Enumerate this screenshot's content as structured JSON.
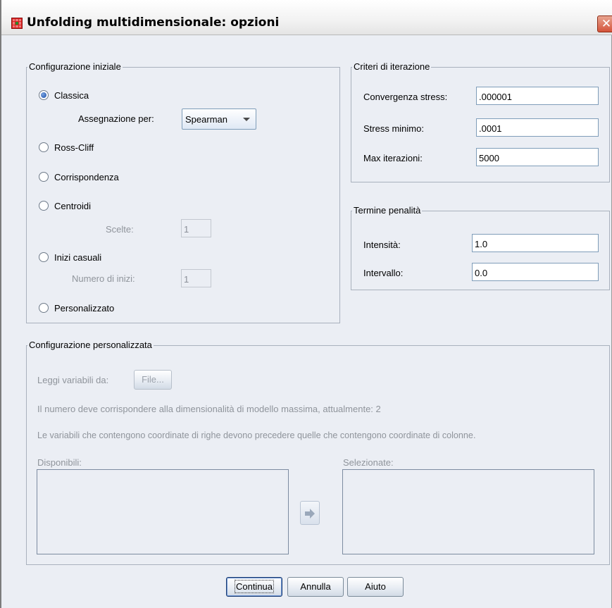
{
  "window": {
    "title": "Unfolding multidimensionale: opzioni",
    "close_glyph": "✕"
  },
  "initial_config": {
    "legend": "Configurazione iniziale",
    "classica": "Classica",
    "assegnazione_label": "Assegnazione per:",
    "assegnazione_value": "Spearman",
    "ross_cliff": "Ross-Cliff",
    "corrispondenza": "Corrispondenza",
    "centroidi": "Centroidi",
    "scelte_label": "Scelte:",
    "scelte_value": "1",
    "inizi_casuali": "Inizi casuali",
    "numero_inizi_label": "Numero di inizi:",
    "numero_inizi_value": "1",
    "personalizzato": "Personalizzato",
    "selected": "Classica"
  },
  "iteration": {
    "legend": "Criteri di iterazione",
    "convergenza_label": "Convergenza stress:",
    "convergenza_value": ".000001",
    "stress_min_label": "Stress minimo:",
    "stress_min_value": ".0001",
    "max_iter_label": "Max iterazioni:",
    "max_iter_value": "5000"
  },
  "penalty": {
    "legend": "Termine penalità",
    "intensita_label": "Intensità:",
    "intensita_value": "1.0",
    "intervallo_label": "Intervallo:",
    "intervallo_value": "0.0"
  },
  "custom_config": {
    "legend": "Configurazione personalizzata",
    "leggi_label": "Leggi variabili da:",
    "file_button": "File...",
    "info1": "Il numero deve corrispondere alla dimensionalità di modello massima, attualmente: 2",
    "info2": "Le variabili che contengono coordinate di righe devono precedere quelle che contengono coordinate di colonne.",
    "disponibili": "Disponibili:",
    "selezionate": "Selezionate:"
  },
  "buttons": {
    "continua": "Continua",
    "annulla": "Annulla",
    "aiuto": "Aiuto"
  },
  "colors": {
    "dialog_bg": "#ebeef4",
    "close_red": "#d4533a",
    "radio_blue": "#1a4fa8"
  }
}
